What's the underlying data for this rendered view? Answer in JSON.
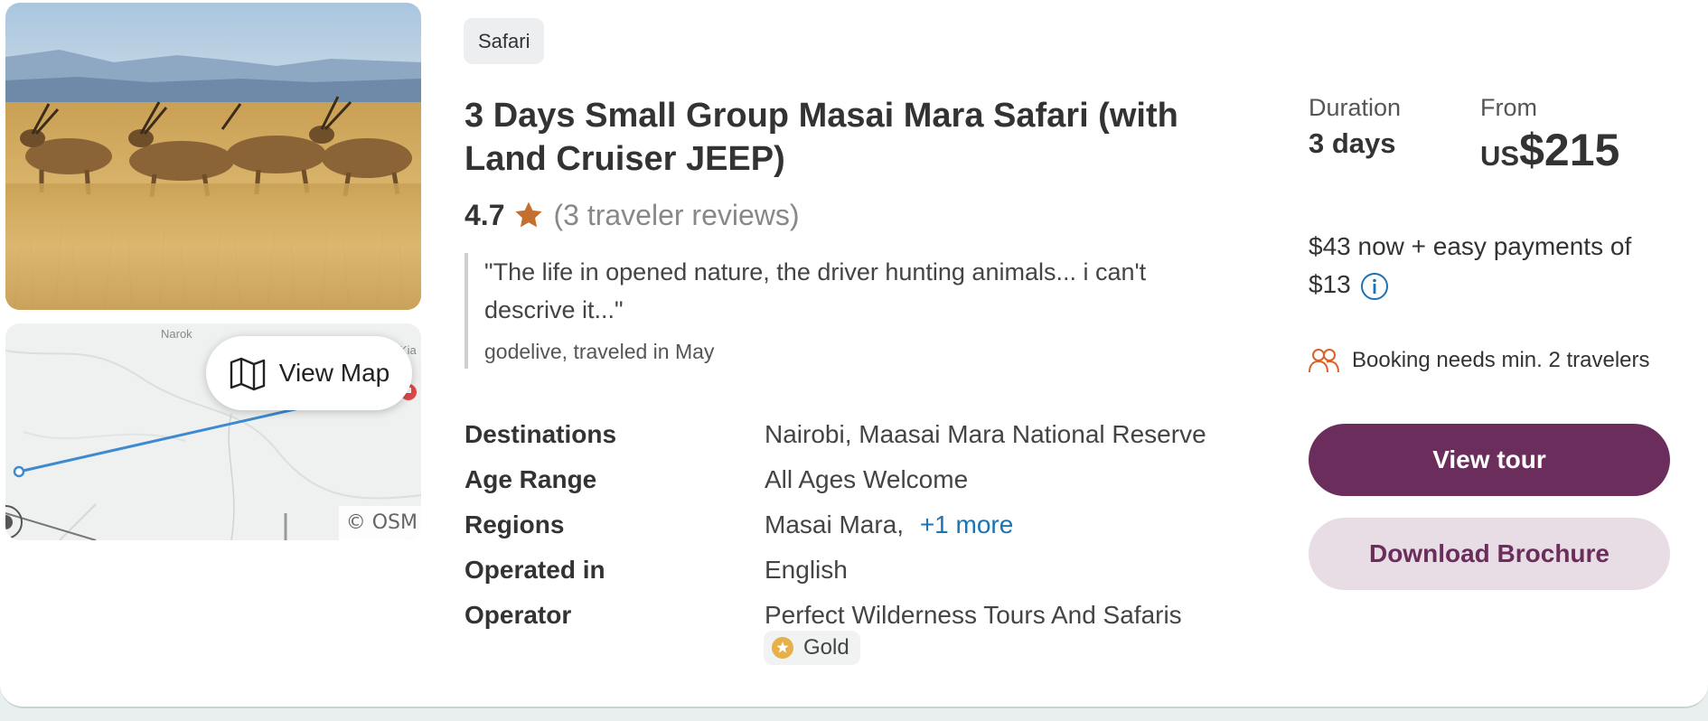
{
  "map": {
    "place_narok": "Narok",
    "place_kia": "Kia",
    "copyright": "© OSM",
    "view_map_label": "View Map"
  },
  "tour": {
    "tag": "Safari",
    "title": "3 Days Small Group Masai Mara Safari (with Land Cruiser JEEP)",
    "rating": "4.7",
    "reviews": "(3 traveler reviews)",
    "quote": "\"The life in opened nature, the driver hunting animals... i can't descrive it...\"",
    "quote_author": "godelive, traveled in May"
  },
  "details": {
    "destinations_label": "Destinations",
    "destinations_value": "Nairobi, Maasai Mara National Reserve",
    "age_label": "Age Range",
    "age_value": "All Ages Welcome",
    "regions_label": "Regions",
    "regions_value": "Masai Mara,",
    "regions_more": "+1 more",
    "operated_label": "Operated in",
    "operated_value": "English",
    "operator_label": "Operator",
    "operator_value": "Perfect Wilderness Tours And Safaris",
    "operator_badge": "Gold"
  },
  "summary": {
    "duration_label": "Duration",
    "duration_value": "3 days",
    "from_label": "From",
    "currency": "US",
    "price": "$215",
    "payments_line1": "$43 now + easy payments of",
    "payments_line2": "$13",
    "booking_note": "Booking needs min. 2 travelers",
    "view_tour": "View tour",
    "download_brochure": "Download Brochure"
  },
  "colors": {
    "primary": "#6b2d5c",
    "secondary_bg": "#e8dce5",
    "link": "#1b73b4",
    "star": "#c46f2d",
    "traveler_icon": "#d9622b"
  }
}
